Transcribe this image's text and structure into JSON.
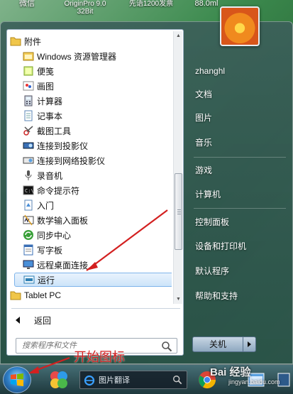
{
  "desktop": {
    "icon_labels": [
      "微信",
      "OriginPro 9.0 32Bit",
      "先语1200发票",
      "88.0ml"
    ]
  },
  "start_menu": {
    "folder_label": "附件",
    "programs": [
      {
        "label": "Windows 资源管理器",
        "icon": "explorer-icon"
      },
      {
        "label": "便笺",
        "icon": "sticky-notes-icon"
      },
      {
        "label": "画图",
        "icon": "paint-icon"
      },
      {
        "label": "计算器",
        "icon": "calculator-icon"
      },
      {
        "label": "记事本",
        "icon": "notepad-icon"
      },
      {
        "label": "截图工具",
        "icon": "snipping-tool-icon"
      },
      {
        "label": "连接到投影仪",
        "icon": "projector-icon"
      },
      {
        "label": "连接到网络投影仪",
        "icon": "network-projector-icon"
      },
      {
        "label": "录音机",
        "icon": "sound-recorder-icon"
      },
      {
        "label": "命令提示符",
        "icon": "command-prompt-icon"
      },
      {
        "label": "入门",
        "icon": "getting-started-icon"
      },
      {
        "label": "数学输入面板",
        "icon": "math-input-icon"
      },
      {
        "label": "同步中心",
        "icon": "sync-center-icon"
      },
      {
        "label": "写字板",
        "icon": "wordpad-icon"
      },
      {
        "label": "远程桌面连接",
        "icon": "remote-desktop-icon"
      },
      {
        "label": "运行",
        "icon": "run-icon",
        "selected": true
      },
      {
        "label": "Tablet PC",
        "icon": "folder-icon"
      }
    ],
    "back_label": "返回",
    "search_placeholder": "搜索程序和文件",
    "right_items": {
      "user": "zhanghl",
      "documents": "文档",
      "pictures": "图片",
      "music": "音乐",
      "games": "游戏",
      "computer": "计算机",
      "control_panel": "控制面板",
      "devices": "设备和打印机",
      "default_programs": "默认程序",
      "help": "帮助和支持"
    },
    "shutdown_label": "关机"
  },
  "annotation": {
    "text": "开始图标",
    "color": "#d32020"
  },
  "taskbar": {
    "search_label": "图片翻译",
    "watermark": "Bai 经验",
    "watermark_sub": "jingyan.baidu.com"
  },
  "colors": {
    "accent": "#3f7fc0",
    "selection_border": "#7eb4ea"
  }
}
